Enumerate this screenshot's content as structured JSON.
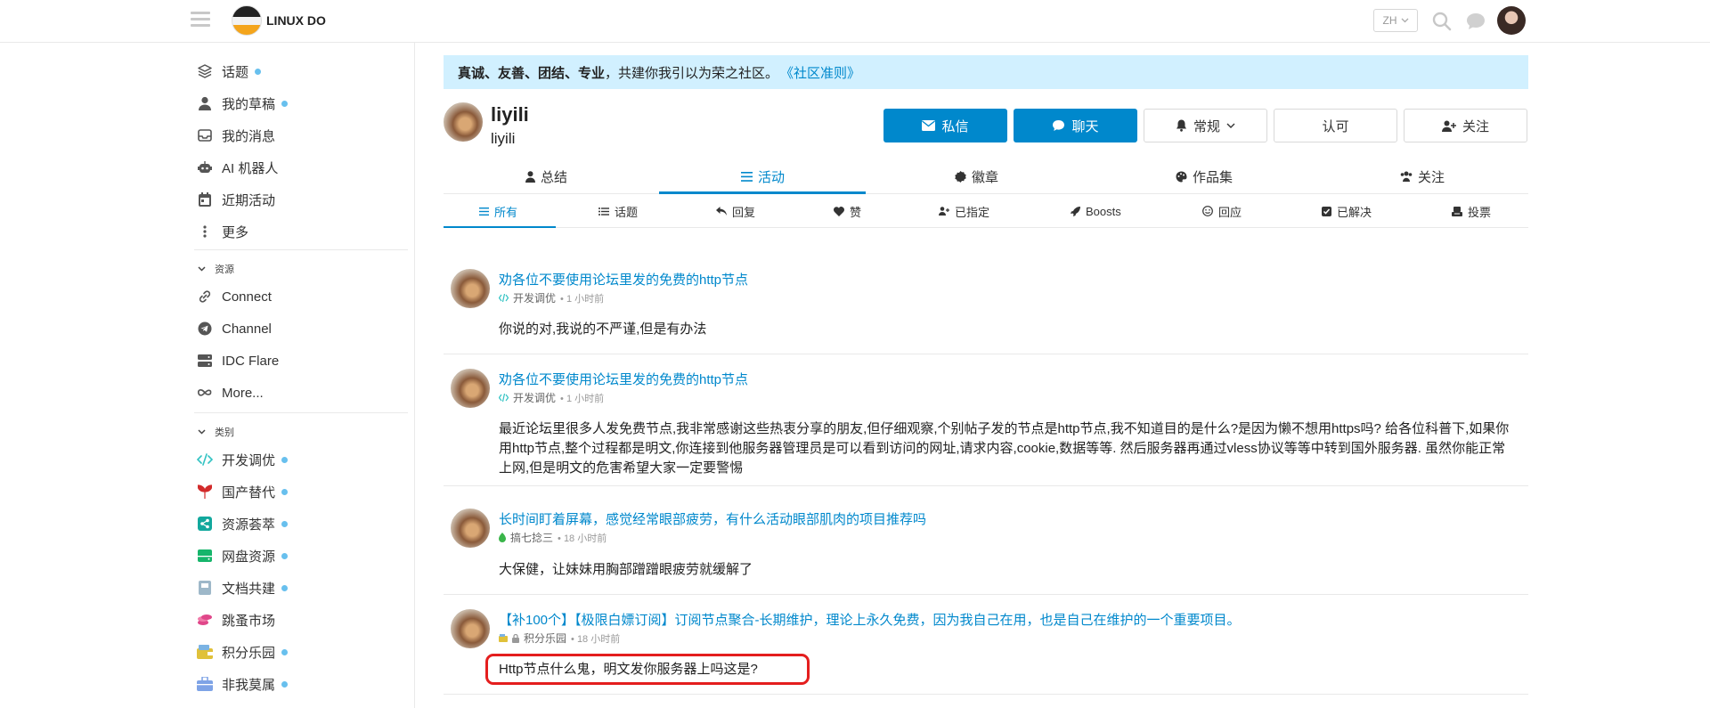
{
  "header": {
    "site_name": "LINUX DO",
    "lang": "ZH"
  },
  "sidebar": {
    "top_items": [
      {
        "label": "话题",
        "icon": "layers-icon",
        "dot": true
      },
      {
        "label": "我的草稿",
        "icon": "user-icon",
        "dot": true
      },
      {
        "label": "我的消息",
        "icon": "inbox-icon",
        "dot": false
      },
      {
        "label": "AI 机器人",
        "icon": "robot-icon",
        "dot": false
      },
      {
        "label": "近期活动",
        "icon": "calendar-icon",
        "dot": false
      },
      {
        "label": "更多",
        "icon": "more-vertical-icon",
        "dot": false
      }
    ],
    "resources_title": "资源",
    "resources": [
      {
        "label": "Connect",
        "icon": "link-icon"
      },
      {
        "label": "Channel",
        "icon": "telegram-icon"
      },
      {
        "label": "IDC Flare",
        "icon": "server-icon"
      },
      {
        "label": "More...",
        "icon": "infinity-icon"
      }
    ],
    "categories_title": "类别",
    "categories": [
      {
        "label": "开发调优",
        "icon": "code-icon",
        "color": "#32c3c3",
        "dot": true
      },
      {
        "label": "国产替代",
        "icon": "sprout-icon",
        "color": "#d22b2b",
        "dot": true
      },
      {
        "label": "资源荟萃",
        "icon": "share-icon",
        "color": "#12a89d",
        "dot": true
      },
      {
        "label": "网盘资源",
        "icon": "hard-drive-icon",
        "color": "#16b56b",
        "dot": true
      },
      {
        "label": "文档共建",
        "icon": "book-icon",
        "color": "#9eb8c9",
        "dot": true
      },
      {
        "label": "跳蚤市场",
        "icon": "coins-icon",
        "color": "#e0478a",
        "dot": false
      },
      {
        "label": "积分乐园",
        "icon": "wallet-icon",
        "color": "#e0c13a",
        "dot": true
      },
      {
        "label": "非我莫属",
        "icon": "briefcase-icon",
        "color": "#7ea3e6",
        "dot": true
      }
    ]
  },
  "banner": {
    "bold_text": "真诚、友善、团结、专业",
    "text": "，共建你我引以为荣之社区。",
    "link": "《社区准则》"
  },
  "profile": {
    "username": "liyili",
    "name": "liyili",
    "buttons": {
      "message": "私信",
      "chat": "聊天",
      "notification": "常规",
      "approve": "认可",
      "follow": "关注"
    },
    "tabs": [
      {
        "label": "总结",
        "icon": "user-icon"
      },
      {
        "label": "活动",
        "icon": "list-icon",
        "active": true
      },
      {
        "label": "徽章",
        "icon": "badge-icon"
      },
      {
        "label": "作品集",
        "icon": "palette-icon"
      },
      {
        "label": "关注",
        "icon": "users-icon"
      }
    ],
    "subtabs": [
      {
        "label": "所有",
        "icon": "list-icon",
        "active": true
      },
      {
        "label": "话题",
        "icon": "list-ul-icon"
      },
      {
        "label": "回复",
        "icon": "reply-icon"
      },
      {
        "label": "赞",
        "icon": "heart-icon"
      },
      {
        "label": "已指定",
        "icon": "user-plus-icon"
      },
      {
        "label": "Boosts",
        "icon": "rocket-icon"
      },
      {
        "label": "回应",
        "icon": "smile-icon"
      },
      {
        "label": "已解决",
        "icon": "check-square-icon"
      },
      {
        "label": "投票",
        "icon": "vote-icon"
      }
    ]
  },
  "posts": [
    {
      "title": "劝各位不要使用论坛里发的免费的http节点",
      "category": "开发调优",
      "time": "1 小时前",
      "body": "你说的对,我说的不严谨,但是有办法"
    },
    {
      "title": "劝各位不要使用论坛里发的免费的http节点",
      "category": "开发调优",
      "time": "1 小时前",
      "body": "最近论坛里很多人发免费节点,我非常感谢这些热衷分享的朋友,但仔细观察,个别帖子发的节点是http节点,我不知道目的是什么?是因为懒不想用https吗? 给各位科普下,如果你用http节点,整个过程都是明文,你连接到他服务器管理员是可以看到访问的网址,请求内容,cookie,数据等等. 然后服务器再通过vless协议等等中转到国外服务器. 虽然你能正常上网,但是明文的危害希望大家一定要警惕"
    },
    {
      "title": "长时间盯着屏幕，感觉经常眼部疲劳，有什么活动眼部肌肉的项目推荐吗",
      "category": "搞七捻三",
      "time": "18 小时前",
      "body": "大保健，让妹妹用胸部蹭蹭眼疲劳就缓解了"
    },
    {
      "title": "【补100个】【极限白嫖订阅】订阅节点聚合-长期维护，理论上永久免费，因为我自己在用，也是自己在维护的一个重要项目。",
      "category": "积分乐园",
      "time": "18 小时前",
      "body": "Http节点什么鬼，明文发你服务器上吗这是?"
    }
  ]
}
